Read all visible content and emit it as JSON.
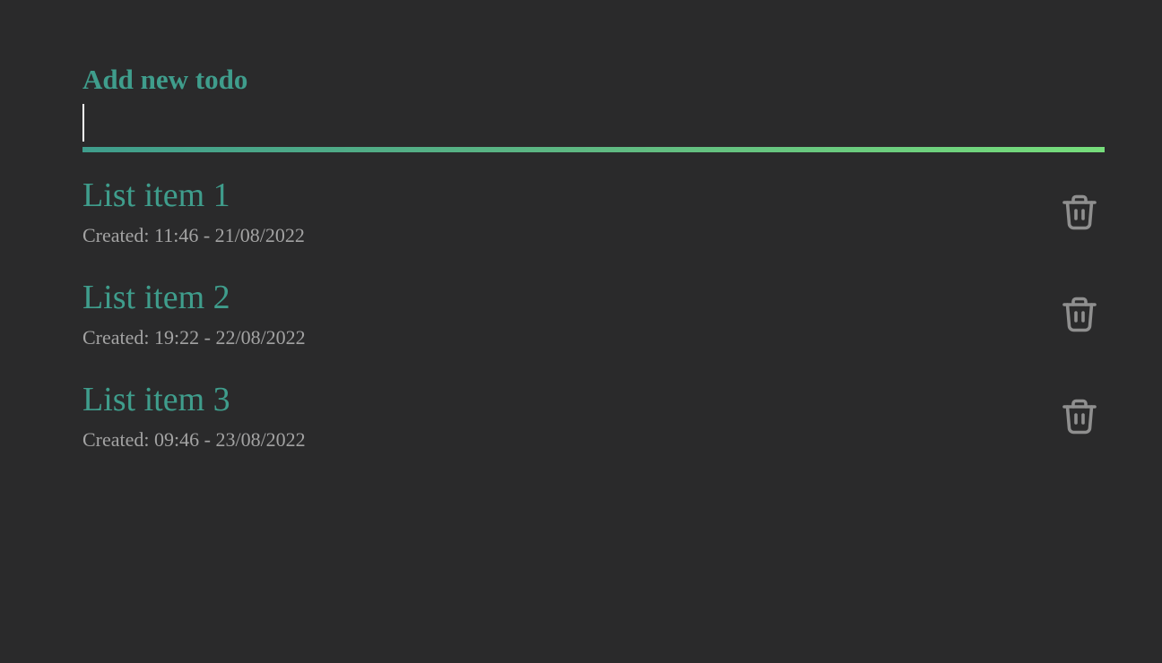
{
  "form": {
    "label": "Add new todo",
    "input_value": "",
    "input_placeholder": ""
  },
  "todos": [
    {
      "title": "List item 1",
      "created": "Created: 11:46 - 21/08/2022",
      "delete_icon": "trash-icon"
    },
    {
      "title": "List item 2",
      "created": "Created: 19:22 - 22/08/2022",
      "delete_icon": "trash-icon"
    },
    {
      "title": "List item 3",
      "created": "Created: 09:46 - 23/08/2022",
      "delete_icon": "trash-icon"
    }
  ],
  "colors": {
    "background": "#2a2a2b",
    "accent": "#3f9d8c",
    "accent_light": "#76dd7b",
    "meta_text": "#a3a3a3",
    "icon": "#8f8f8f"
  }
}
